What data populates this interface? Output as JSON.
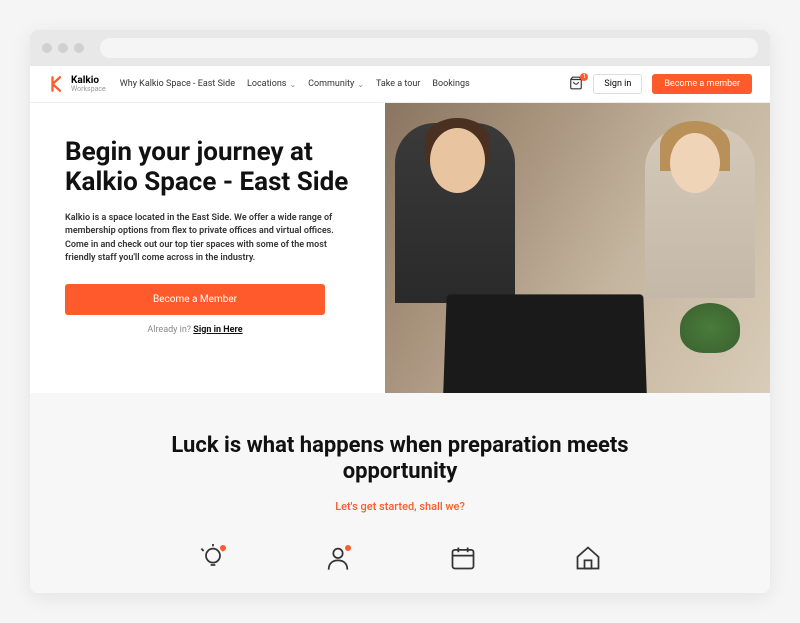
{
  "brand": {
    "name": "Kalkio",
    "sub": "Workspace"
  },
  "nav": {
    "items": [
      {
        "label": "Why Kalkio Space - East Side",
        "dropdown": false
      },
      {
        "label": "Locations",
        "dropdown": true
      },
      {
        "label": "Community",
        "dropdown": true
      },
      {
        "label": "Take a tour",
        "dropdown": false
      },
      {
        "label": "Bookings",
        "dropdown": false
      }
    ],
    "cart_badge": "1",
    "signin": "Sign in",
    "cta": "Become a member"
  },
  "hero": {
    "title": "Begin your journey at Kalkio Space - East Side",
    "desc": "Kalkio is a space located in the East Side. We offer a wide range of membership options from flex to private offices and virtual offices. Come in and check out our top tier spaces with some of the most friendly staff you'll come across in the industry.",
    "cta": "Become a Member",
    "already_prefix": "Already in? ",
    "already_link": "Sign in Here"
  },
  "section2": {
    "title": "Luck is what happens when preparation meets opportunity",
    "sub": "Let's get started, shall we?"
  },
  "colors": {
    "accent": "#ff5a2c"
  }
}
